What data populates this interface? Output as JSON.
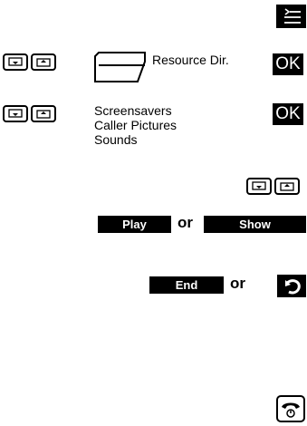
{
  "menu_icon": "menu-list-icon",
  "rows": [
    {
      "nav_icons": [
        "nav-down-key-icon",
        "nav-up-key-icon"
      ],
      "folder_icon": "folder-icon",
      "label": "Resource Dir.",
      "ok_label": "OK"
    },
    {
      "nav_icons": [
        "nav-down-key-icon",
        "nav-up-key-icon"
      ],
      "items": [
        "Screensavers",
        "Caller Pictures",
        "Sounds"
      ],
      "ok_label": "OK"
    }
  ],
  "softkeys": {
    "play_label": "Play",
    "or_1": "or",
    "show_label": "Show",
    "end_label": "End",
    "or_2": "or"
  },
  "icons": {
    "back": "back-arrow-icon",
    "handset": "end-call-handset-icon"
  }
}
